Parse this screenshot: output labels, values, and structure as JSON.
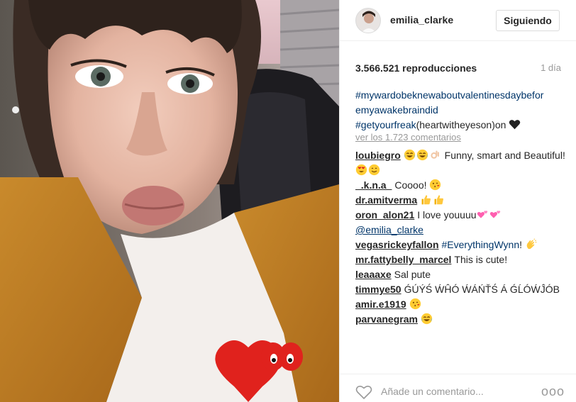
{
  "post": {
    "author": "emilia_clarke",
    "follow_label": "Siguiendo",
    "views": "3.566.521 reproducciones",
    "time": "1 día"
  },
  "caption": {
    "tag1_line1": "#mywardobeknewaboutvalentinesdaybefor",
    "tag1_line2": "emyawakebraindid",
    "tag2": "#getyourfreak",
    "text_after": "(heartwitheyeson)on",
    "emoji": "heart"
  },
  "view_all_comments": "ver los 1.723 comentarios",
  "comments": [
    {
      "user": "loubiegro",
      "parts": [
        {
          "emoji": "tears-of-joy"
        },
        {
          "emoji": "tears-of-joy"
        },
        {
          "emoji": "ok-hand"
        },
        {
          "text": " Funny, smart and Beautiful!"
        },
        {
          "emoji": "heart-eyes"
        },
        {
          "emoji": "smile"
        }
      ]
    },
    {
      "user": "_.k.n.a_",
      "parts": [
        {
          "text": "Coooo! "
        },
        {
          "emoji": "kiss-face"
        }
      ]
    },
    {
      "user": "dr.amitverma",
      "parts": [
        {
          "emoji": "thumbs-up"
        },
        {
          "emoji": "thumbs-up"
        }
      ]
    },
    {
      "user": "oron_alon21",
      "parts": [
        {
          "text": "I love youuuu"
        },
        {
          "emoji": "two-hearts"
        },
        {
          "emoji": "two-hearts"
        }
      ],
      "mention": "@emilia_clarke"
    },
    {
      "user": "vegasrickeyfallon",
      "parts": [
        {
          "tag": "#EverythingWynn"
        },
        {
          "text": "! "
        },
        {
          "emoji": "clap"
        }
      ]
    },
    {
      "user": "mr.fattybelly_marcel",
      "parts": [
        {
          "text": "This is cute!"
        }
      ]
    },
    {
      "user": "leaaaxe",
      "parts": [
        {
          "text": "Sal pute"
        }
      ]
    },
    {
      "user": "timmye50",
      "parts": [
        {
          "text": "ǴÚÝŚ ẂĤÓ ẂÁŃŤŚ Á ǴĹÓẂĴÓB"
        }
      ]
    },
    {
      "user": "amir.e1919",
      "parts": [
        {
          "emoji": "kiss-face"
        }
      ]
    },
    {
      "user": "parvanegram",
      "parts": [
        {
          "emoji": "tears-of-joy"
        }
      ]
    }
  ],
  "footer": {
    "comment_placeholder": "Añade un comentario...",
    "more_label": "ooo"
  },
  "icons": {
    "like": "heart-outline-icon",
    "options": "more-options-icon"
  },
  "colors": {
    "link": "#003569",
    "muted": "#999999",
    "border": "#dbdbdb"
  }
}
